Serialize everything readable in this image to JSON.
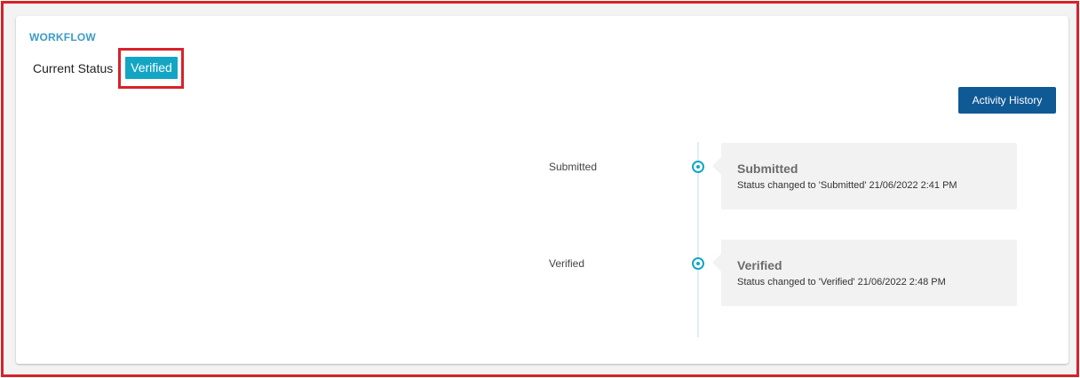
{
  "workflow": {
    "title": "WORKFLOW",
    "current_status_label": "Current Status",
    "current_status_value": "Verified",
    "activity_history_label": "Activity History"
  },
  "timeline": [
    {
      "label": "Submitted",
      "card_title": "Submitted",
      "description": "Status changed to 'Submitted' 21/06/2022 2:41 PM"
    },
    {
      "label": "Verified",
      "card_title": "Verified",
      "description": "Status changed to 'Verified' 21/06/2022 2:48 PM"
    }
  ],
  "colors": {
    "accent": "#13a6c4",
    "title": "#3c9cc8",
    "button": "#0f5994",
    "highlight_border": "#d7222a"
  },
  "icons": {
    "timeline_marker": "radio-dot-icon"
  }
}
